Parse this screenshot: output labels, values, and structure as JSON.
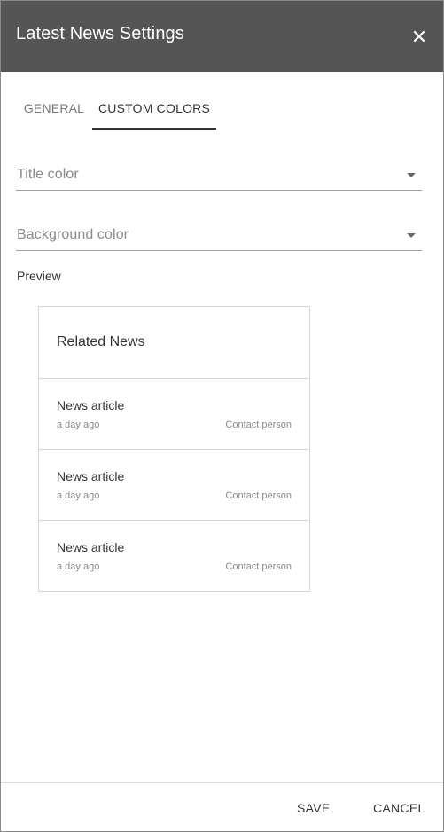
{
  "header": {
    "title": "Latest News Settings",
    "close_icon": "close-icon",
    "background_color": "#555555"
  },
  "tabs": [
    {
      "label": "GENERAL",
      "active": false
    },
    {
      "label": "CUSTOM COLORS",
      "active": true
    }
  ],
  "fields": {
    "title_color": {
      "label": "Title color",
      "icon": "caret-down-icon"
    },
    "background_color": {
      "label": "Background color",
      "icon": "caret-down-icon"
    }
  },
  "preview": {
    "label": "Preview",
    "card_title": "Related News",
    "items": [
      {
        "title": "News article",
        "date": "a day ago",
        "contact": "Contact person"
      },
      {
        "title": "News article",
        "date": "a day ago",
        "contact": "Contact person"
      },
      {
        "title": "News article",
        "date": "a day ago",
        "contact": "Contact person"
      }
    ]
  },
  "footer": {
    "save_label": "SAVE",
    "cancel_label": "CANCEL"
  }
}
